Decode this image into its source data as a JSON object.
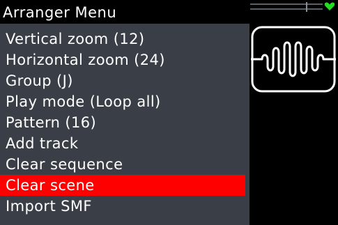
{
  "menu": {
    "title": "Arranger Menu",
    "items": [
      {
        "label": "Vertical zoom (12)"
      },
      {
        "label": "Horizontal zoom (24)"
      },
      {
        "label": "Group (J)"
      },
      {
        "label": "Play mode (Loop all)"
      },
      {
        "label": "Pattern (16)"
      },
      {
        "label": "Add track"
      },
      {
        "label": "Clear sequence"
      },
      {
        "label": "Clear scene",
        "selected": true
      },
      {
        "label": "Import SMF"
      }
    ]
  },
  "status": {
    "icon": "heart-icon",
    "color": "#22dd22"
  },
  "preview": {
    "icon": "waveform-icon"
  },
  "colors": {
    "panel_background": "#3a3f47",
    "selection": "#ff0000",
    "screen_background": "#000000",
    "text": "#ffffff"
  }
}
